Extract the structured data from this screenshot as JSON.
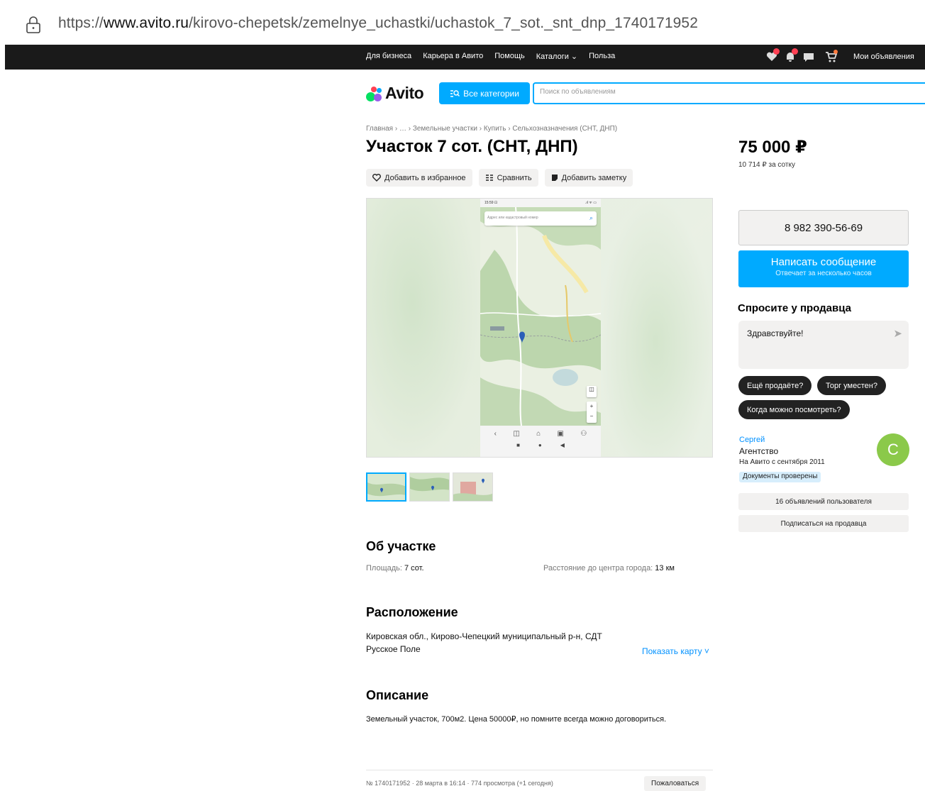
{
  "browser": {
    "url_prefix": "https://",
    "url_domain": "www.avito.ru",
    "url_path": "/kirovo-chepetsk/zemelnye_uchastki/uchastok_7_sot._snt_dnp_1740171952"
  },
  "topnav": {
    "links": [
      "Для бизнеса",
      "Карьера в Авито",
      "Помощь",
      "Каталоги ⌄",
      "Польза"
    ],
    "my_ads": "Мои объявления"
  },
  "header": {
    "logo": "Avito",
    "categories_button": "Все категории",
    "search_placeholder": "Поиск по объявлениям"
  },
  "listing": {
    "breadcrumb": "Главная › … › Земельные участки › Купить › Сельхозназначения (СНТ, ДНП)",
    "title": "Участок 7 сот. (СНТ, ДНП)",
    "price": "75 000 ₽",
    "price_per_unit": "10 714 ₽ за сотку",
    "actions": {
      "favorite": "Добавить в избранное",
      "compare": "Сравнить",
      "note": "Добавить заметку"
    },
    "photo_phone_time": "15:59 ⊡",
    "photo_search_placeholder": "Адрес или кадастровый номер"
  },
  "sidebar": {
    "phone": "8 982 390-56-69",
    "message_button": "Написать сообщение",
    "message_sub": "Отвечает за несколько часов",
    "ask_title": "Спросите у продавца",
    "ask_text": "Здравствуйте!",
    "chips": [
      "Ещё продаёте?",
      "Торг уместен?",
      "Когда можно посмотреть?"
    ],
    "seller_name": "Сергей",
    "seller_type": "Агентство",
    "seller_since": "На Авито с сентября 2011",
    "verified": "Документы проверены",
    "avatar_letter": "С",
    "user_ads": "16 объявлений пользователя",
    "subscribe": "Подписаться на продавца"
  },
  "about": {
    "title": "Об участке",
    "area_label": "Площадь: ",
    "area_value": "7 сот.",
    "distance_label": "Расстояние до центра города: ",
    "distance_value": "13 км"
  },
  "location": {
    "title": "Расположение",
    "address": "Кировская обл., Кирово-Чепецкий муниципальный р-н, СДТ Русское Поле",
    "show_map": "Показать карту ˅"
  },
  "description": {
    "title": "Описание",
    "text": "Земельный участок, 700м2. Цена 50000₽, но помните всегда можно договориться."
  },
  "footer": {
    "meta": "№ 1740171952 · 28 марта в 16:14 · 774 просмотра (+1 сегодня)",
    "report": "Пожаловаться"
  },
  "colors": {
    "accent": "#00aaff",
    "link": "#0091ff",
    "topbar": "#1a1a1a",
    "avatar": "#8bc94a"
  }
}
